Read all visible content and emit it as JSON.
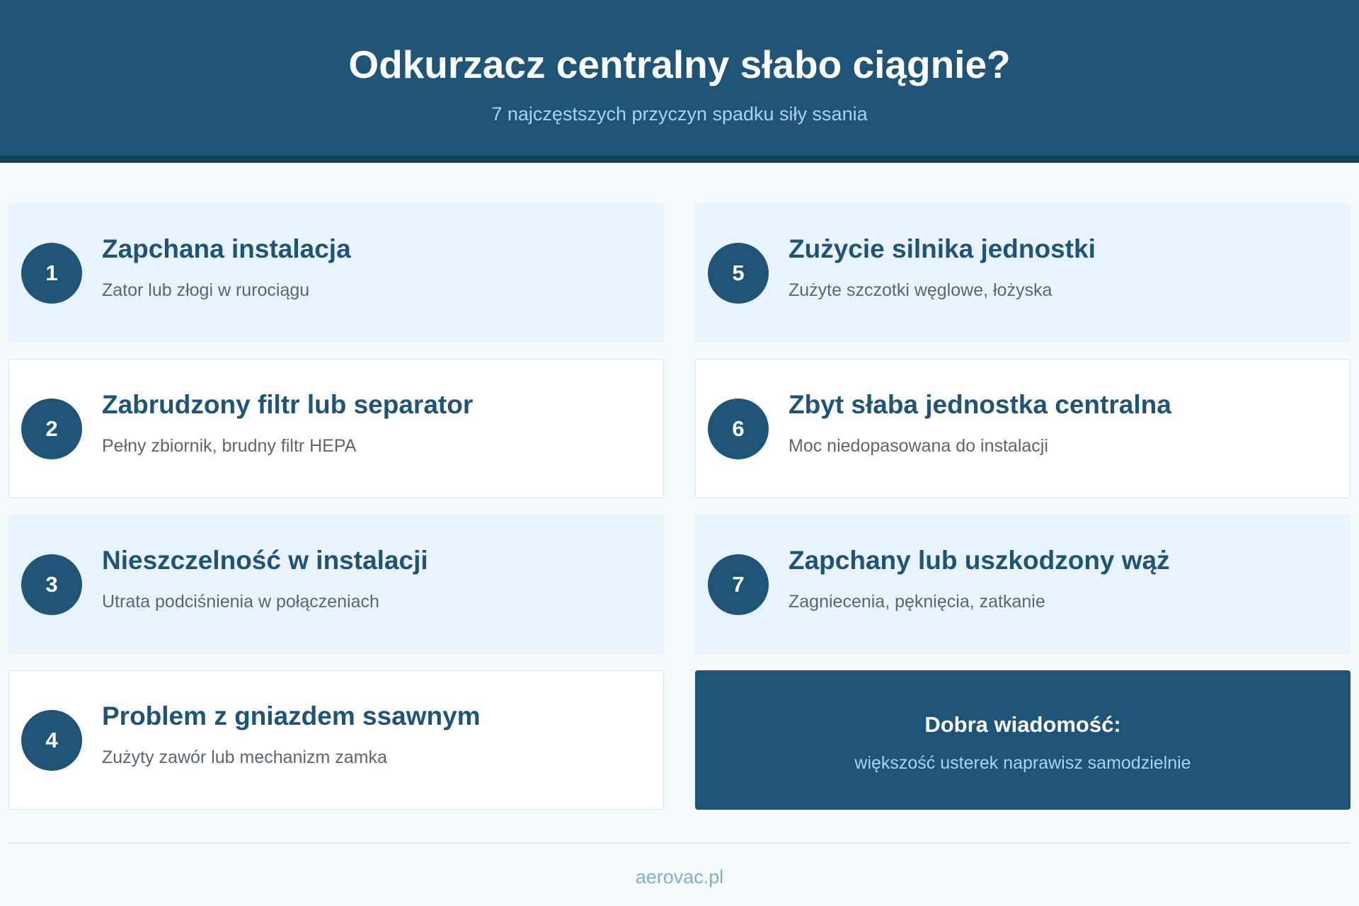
{
  "header": {
    "title": "Odkurzacz centralny słabo ciągnie?",
    "subtitle": "7 najczęstszych przyczyn spadku siły ssania"
  },
  "causes": [
    {
      "number": "1",
      "title": "Zapchana instalacja",
      "description": "Zator lub złogi w rurociągu"
    },
    {
      "number": "2",
      "title": "Zabrudzony filtr lub separator",
      "description": "Pełny zbiornik, brudny filtr HEPA"
    },
    {
      "number": "3",
      "title": "Nieszczelność w instalacji",
      "description": "Utrata podciśnienia w połączeniach"
    },
    {
      "number": "4",
      "title": "Problem z gniazdem ssawnym",
      "description": "Zużyty zawór lub mechanizm zamka"
    },
    {
      "number": "5",
      "title": "Zużycie silnika jednostki",
      "description": "Zużyte szczotki węglowe, łożyska"
    },
    {
      "number": "6",
      "title": "Zbyt słaba jednostka centralna",
      "description": "Moc niedopasowana do instalacji"
    },
    {
      "number": "7",
      "title": "Zapchany lub uszkodzony wąż",
      "description": "Zagniecenia, pęknięcia, zatkanie"
    }
  ],
  "good_news": {
    "title": "Dobra wiadomość:",
    "text": "większość usterek naprawisz samodzielnie"
  },
  "footer": {
    "site": "aerovac.pl"
  },
  "colors": {
    "primary": "#1e5478",
    "accent_light": "#a9d3ee",
    "card_tint": "#e9f3fc",
    "background": "#f5fafc"
  }
}
